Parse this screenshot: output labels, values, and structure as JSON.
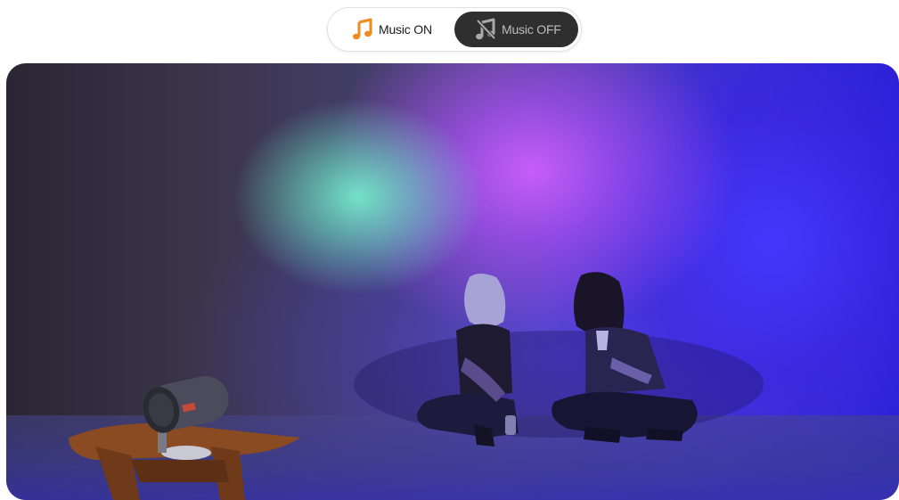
{
  "toggle": {
    "on_label": "Music ON",
    "off_label": "Music OFF",
    "on_icon": "music-note-icon",
    "off_icon": "music-off-icon",
    "selected": "off"
  },
  "hero": {
    "colors": {
      "accent_orange": "#f08a1c",
      "pill_dark": "#2f2f2f",
      "light_cyan": "#78ffd2",
      "light_purple": "#cd5fff",
      "light_blue": "#3b2fd0"
    }
  }
}
